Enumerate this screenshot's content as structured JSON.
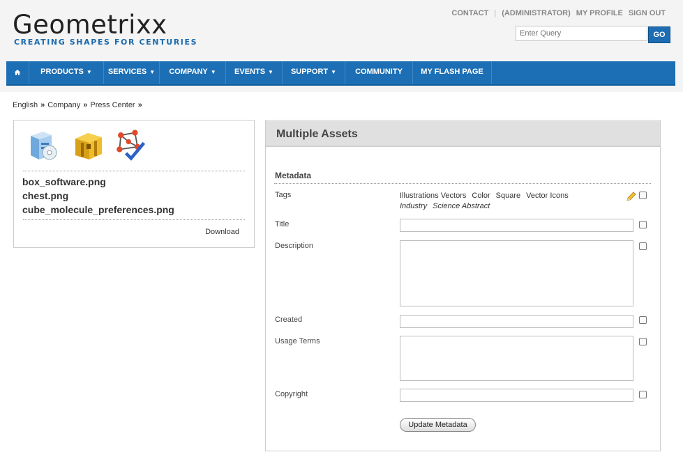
{
  "brand": {
    "title": "Geometrixx",
    "tagline": "CREATING SHAPES FOR CENTURIES"
  },
  "toplinks": {
    "contact": "CONTACT",
    "admin": "(ADMINISTRATOR)",
    "profile": "MY PROFILE",
    "signout": "SIGN OUT"
  },
  "search": {
    "placeholder": "Enter Query",
    "button": "GO"
  },
  "nav": {
    "products": "PRODUCTS",
    "services": "SERVICES",
    "company": "COMPANY",
    "events": "EVENTS",
    "support": "SUPPORT",
    "community": "COMMUNITY",
    "flash": "MY FLASH PAGE"
  },
  "breadcrumb": [
    "English",
    "Company",
    "Press Center"
  ],
  "files": [
    "box_software.png",
    "chest.png",
    "cube_molecule_preferences.png"
  ],
  "download": "Download",
  "panel": {
    "title": "Multiple Assets",
    "section": "Metadata",
    "labels": {
      "tags": "Tags",
      "title": "Title",
      "description": "Description",
      "created": "Created",
      "usage": "Usage Terms",
      "copyright": "Copyright"
    },
    "tags": [
      "Illustrations Vectors",
      "Color",
      "Square",
      "Vector Icons"
    ],
    "tags_italic": [
      "Industry",
      "Science Abstract"
    ],
    "update": "Update Metadata"
  }
}
